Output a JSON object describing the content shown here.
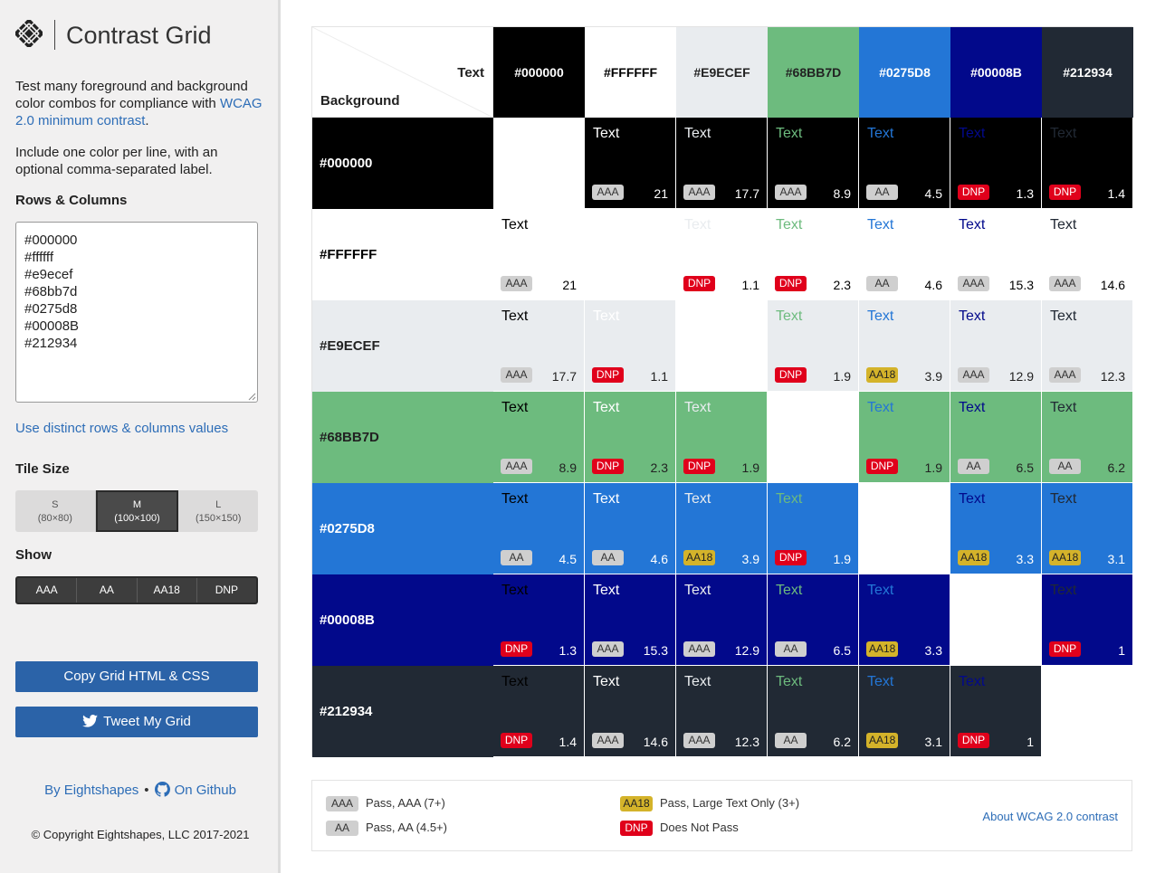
{
  "app": {
    "title": "Contrast Grid",
    "logo_icon": "eightshapes-logo-icon"
  },
  "sidebar": {
    "intro_prefix": "Test many foreground and background color combos for compliance with ",
    "intro_link": "WCAG 2.0 minimum contrast",
    "intro_suffix": ".",
    "intro2": "Include one color per line, with an optional comma-separated label.",
    "rows_label": "Rows & Columns",
    "colors_text": "#000000\n#ffffff\n#e9ecef\n#68bb7d\n#0275d8\n#00008B\n#212934",
    "distinct_link": "Use distinct rows & columns values",
    "tile_size_label": "Tile Size",
    "tile_sizes": [
      {
        "label": "S",
        "dims": "(80×80)",
        "active": false
      },
      {
        "label": "M",
        "dims": "(100×100)",
        "active": true
      },
      {
        "label": "L",
        "dims": "(150×150)",
        "active": false
      }
    ],
    "show_label": "Show",
    "show_options": [
      "AAA",
      "AA",
      "AA18",
      "DNP"
    ],
    "copy_button": "Copy Grid HTML & CSS",
    "tweet_button": "Tweet My Grid",
    "by_link": "By Eightshapes",
    "github_link": "On Github",
    "copyright": "© Copyright Eightshapes, LLC 2017-2021"
  },
  "grid": {
    "corner_text": "Text",
    "corner_background": "Background",
    "sample_text": "Text",
    "colors": [
      {
        "label": "#000000",
        "hex": "#000000",
        "head_text": "#ffffff"
      },
      {
        "label": "#FFFFFF",
        "hex": "#ffffff",
        "head_text": "#000000"
      },
      {
        "label": "#E9ECEF",
        "hex": "#e9ecef",
        "head_text": "#222222"
      },
      {
        "label": "#68BB7D",
        "hex": "#6dbb7e",
        "head_text": "#222222"
      },
      {
        "label": "#0275D8",
        "hex": "#2376d6",
        "head_text": "#ffffff"
      },
      {
        "label": "#00008B",
        "hex": "#02098b",
        "head_text": "#ffffff"
      },
      {
        "label": "#212934",
        "hex": "#212934",
        "head_text": "#ffffff"
      }
    ],
    "rows": [
      [
        null,
        [
          "AAA",
          "21"
        ],
        [
          "AAA",
          "17.7"
        ],
        [
          "AAA",
          "8.9"
        ],
        [
          "AA",
          "4.5"
        ],
        [
          "DNP",
          "1.3"
        ],
        [
          "DNP",
          "1.4"
        ]
      ],
      [
        [
          "AAA",
          "21"
        ],
        null,
        [
          "DNP",
          "1.1"
        ],
        [
          "DNP",
          "2.3"
        ],
        [
          "AA",
          "4.6"
        ],
        [
          "AAA",
          "15.3"
        ],
        [
          "AAA",
          "14.6"
        ]
      ],
      [
        [
          "AAA",
          "17.7"
        ],
        [
          "DNP",
          "1.1"
        ],
        null,
        [
          "DNP",
          "1.9"
        ],
        [
          "AA18",
          "3.9"
        ],
        [
          "AAA",
          "12.9"
        ],
        [
          "AAA",
          "12.3"
        ]
      ],
      [
        [
          "AAA",
          "8.9"
        ],
        [
          "DNP",
          "2.3"
        ],
        [
          "DNP",
          "1.9"
        ],
        null,
        [
          "DNP",
          "1.9"
        ],
        [
          "AA",
          "6.5"
        ],
        [
          "AA",
          "6.2"
        ]
      ],
      [
        [
          "AA",
          "4.5"
        ],
        [
          "AA",
          "4.6"
        ],
        [
          "AA18",
          "3.9"
        ],
        [
          "DNP",
          "1.9"
        ],
        null,
        [
          "AA18",
          "3.3"
        ],
        [
          "AA18",
          "3.1"
        ]
      ],
      [
        [
          "DNP",
          "1.3"
        ],
        [
          "AAA",
          "15.3"
        ],
        [
          "AAA",
          "12.9"
        ],
        [
          "AA",
          "6.5"
        ],
        [
          "AA18",
          "3.3"
        ],
        null,
        [
          "DNP",
          "1"
        ]
      ],
      [
        [
          "DNP",
          "1.4"
        ],
        [
          "AAA",
          "14.6"
        ],
        [
          "AAA",
          "12.3"
        ],
        [
          "AA",
          "6.2"
        ],
        [
          "AA18",
          "3.1"
        ],
        [
          "DNP",
          "1"
        ],
        null
      ]
    ]
  },
  "legend": {
    "aaa_badge": "AAA",
    "aaa_text": "Pass, AAA (7+)",
    "aa_badge": "AA",
    "aa_text": "Pass, AA (4.5+)",
    "aa18_badge": "AA18",
    "aa18_text": "Pass, Large Text Only (3+)",
    "dnp_badge": "DNP",
    "dnp_text": "Does Not Pass",
    "about_link": "About WCAG 2.0 contrast"
  },
  "colors": {
    "link": "#2d6db7",
    "button": "#2b63a8",
    "badge_pass": "#cfcfcf",
    "badge_aa18": "#d4b32a",
    "badge_dnp": "#e0001b"
  }
}
